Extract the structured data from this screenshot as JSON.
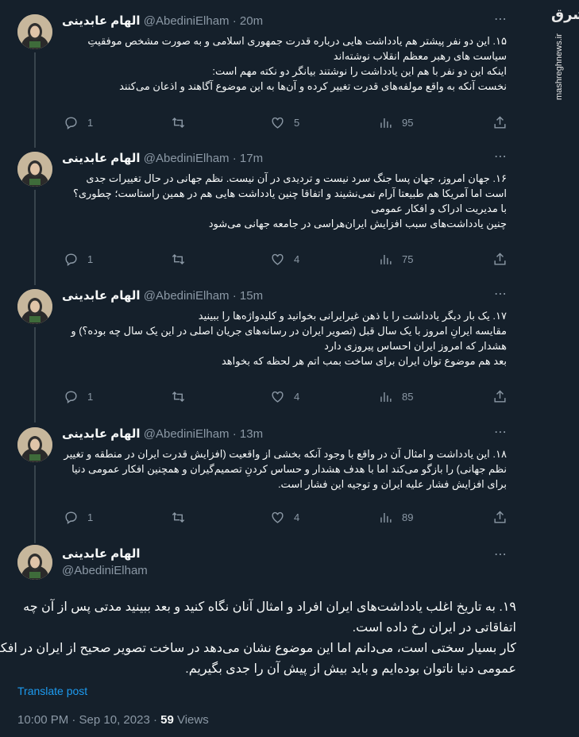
{
  "author": {
    "name": "الهام عابدینی",
    "handle": "@AbediniElham"
  },
  "tweets": [
    {
      "time": "20m",
      "lines": [
        "۱۵. این دو نفر پیشتر هم یادداشت هایی درباره قدرت جمهوری اسلامی و به صورت مشخص موفقیتِ",
        "سیاست های رهبر معظم انقلاب نوشته‌اند",
        "اینکه این دو نفر با هم این یادداشت را نوشتند بیانگر دو نکته مهم است:",
        "نخست آنکه به واقع مولفه‌های قدرت تغییر کرده و آن‌ها به این موضوع آگاهند و اذعان می‌کنند"
      ],
      "replies": "1",
      "retweets": "",
      "likes": "5",
      "views": "95"
    },
    {
      "time": "17m",
      "lines": [
        "۱۶. جهان امروز، جهان پسا جنگ سرد نیست و تردیدی در آن نیست. نظم جهانی در حال تغییرات جدی",
        "است اما آمریکا هم طبیعتا آرام نمی‌نشیند و اتفاقا چنین یادداشت هایی هم در همین راستاست؛ چطوری؟",
        "با مدیریت ادراک و افکار عمومی",
        "چنین یادداشت‌های سبب افزایش ایران‌هراسی در جامعه جهانی می‌شود"
      ],
      "replies": "1",
      "retweets": "",
      "likes": "4",
      "views": "75"
    },
    {
      "time": "15m",
      "lines": [
        "۱۷. یک بار دیگر یادداشت را با ذهن غیرایرانی بخوانید و کلیدواژه‌ها را ببینید",
        "مقایسه ایرانِ امروز با یک سال قبل (تصویر ایران در رسانه‌های جریان اصلی در این یک سال چه بوده؟) و",
        "هشدار که امروز ایران احساس پیروزی دارد",
        "بعد هم موضوع توان ایران برای ساخت بمب اتم هر لحظه که بخواهد"
      ],
      "replies": "1",
      "retweets": "",
      "likes": "4",
      "views": "85"
    },
    {
      "time": "13m",
      "lines": [
        "۱۸. این یادداشت و امثال آن در واقع با وجود آنکه بخشی از واقعیت (افزایش قدرت ایران در منطقه و تغییر",
        "نظم جهانی) را بازگو می‌کند اما با هدف هشدار و حساس کردنِ تصمیم‌گیران و همچنین افکار عمومی دنیا",
        "برای افزایش فشار علیه ایران و توجیه این فشار است."
      ],
      "replies": "1",
      "retweets": "",
      "likes": "4",
      "views": "89"
    }
  ],
  "main_tweet": {
    "lines": [
      "۱۹. به تاریخ اغلب یادداشت‌های ایران افراد و امثال آنان نگاه کنید و بعد ببینید مدتی پس از آن چه",
      "اتفاقاتی در ایران رخ داده است.",
      "کار بسیار سختی است، می‌دانم اما این موضوع نشان می‌دهد در ساخت تصویر صحیح از ایران در افکار",
      "عمومی دنیا ناتوان بوده‌ایم و باید بیش از پیش آن را جدی بگیریم."
    ],
    "translate": "Translate post",
    "timestamp": "10:00 PM · Sep 10, 2023 · ",
    "views_count": "59",
    "views_label": " Views"
  },
  "watermark": {
    "mark": "مشرق",
    "site": "mashreghnews.ir"
  },
  "more_icon": "⋯",
  "dot": " · "
}
